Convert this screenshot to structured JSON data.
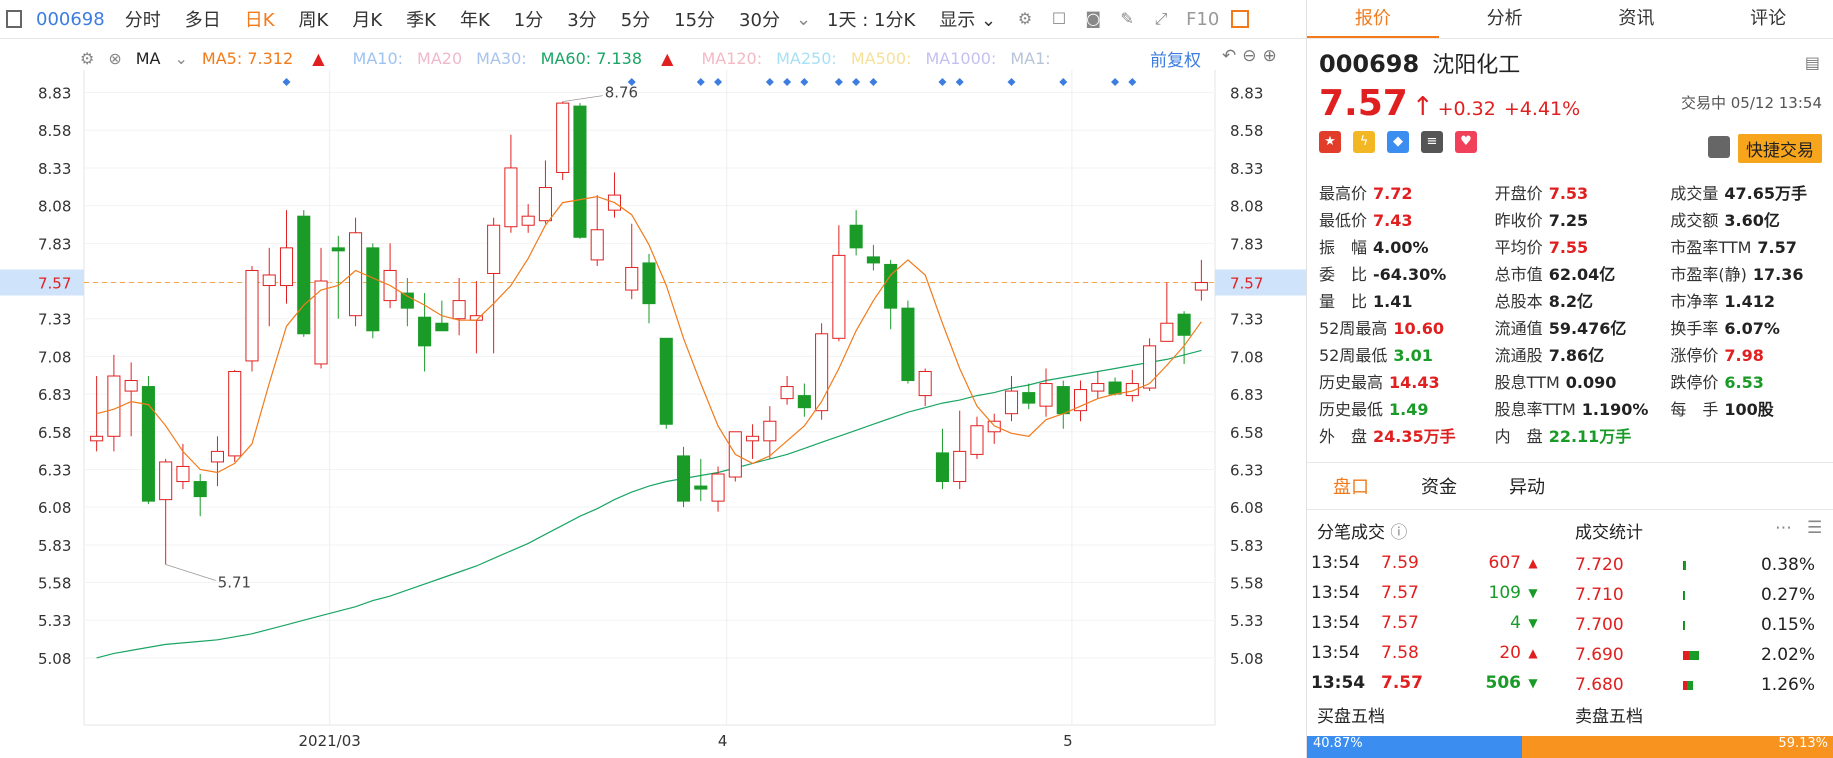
{
  "toolbar": {
    "code": "000698",
    "periods": [
      "分时",
      "多日",
      "日K",
      "周K",
      "月K",
      "季K",
      "年K",
      "1分",
      "3分",
      "5分",
      "15分",
      "30分"
    ],
    "active_period": "日K",
    "interval": "1天 : 1分K",
    "display": "显示",
    "f10": "F10"
  },
  "ma": {
    "label": "MA",
    "ma5": "MA5: 7.312",
    "ma10": "MA10:",
    "ma20": "MA20",
    "ma30": "MA30:",
    "ma60": "MA60: 7.138",
    "ma120": "MA120:",
    "ma250": "MA250:",
    "ma500": "MA500:",
    "ma1000": "MA1000:",
    "ma1": "MA1:",
    "fuquan": "前复权",
    "colors": {
      "ma5": "#f27a1a",
      "ma10": "#9ec3f0",
      "ma20": "#f0b8cc",
      "ma30": "#a8c4ec",
      "ma60": "#1aa564",
      "ma120": "#f3b9c5",
      "ma250": "#a8e0f5",
      "ma500": "#f5e19a",
      "ma1000": "#c5c0f0",
      "ma1": "#b8c4d8"
    }
  },
  "chart_data": {
    "type": "candlestick",
    "ylim": [
      5.0,
      8.9
    ],
    "y_ticks": [
      "8.83",
      "8.58",
      "8.33",
      "8.08",
      "7.83",
      "7.57",
      "7.33",
      "7.08",
      "6.83",
      "6.58",
      "6.33",
      "6.08",
      "5.83",
      "5.58",
      "5.33",
      "5.08"
    ],
    "x_labels": [
      "2021/03",
      "4",
      "5"
    ],
    "current_price": "7.57",
    "annot_high": "8.76",
    "annot_low": "5.71",
    "up_color": "#e02020",
    "down_color": "#1a9b28",
    "ma5_color": "#f27a1a",
    "ma60_color": "#1aa564",
    "candles": [
      [
        6.52,
        6.55,
        6.45,
        6.95
      ],
      [
        6.55,
        6.95,
        6.45,
        7.09
      ],
      [
        6.85,
        6.92,
        6.55,
        7.04
      ],
      [
        6.88,
        6.12,
        6.1,
        6.95
      ],
      [
        6.13,
        6.38,
        5.7,
        6.4
      ],
      [
        6.25,
        6.35,
        6.2,
        6.5
      ],
      [
        6.25,
        6.15,
        6.02,
        6.3
      ],
      [
        6.38,
        6.45,
        6.22,
        6.55
      ],
      [
        6.42,
        6.98,
        6.38,
        6.99
      ],
      [
        7.05,
        7.65,
        6.98,
        7.68
      ],
      [
        7.55,
        7.62,
        7.28,
        7.8
      ],
      [
        7.55,
        7.8,
        7.43,
        8.05
      ],
      [
        8.01,
        7.23,
        7.21,
        8.05
      ],
      [
        7.03,
        7.58,
        7.0,
        7.8
      ],
      [
        7.8,
        7.78,
        7.33,
        7.88
      ],
      [
        7.35,
        7.9,
        7.28,
        8.0
      ],
      [
        7.8,
        7.25,
        7.2,
        7.83
      ],
      [
        7.45,
        7.65,
        7.4,
        7.83
      ],
      [
        7.5,
        7.4,
        7.28,
        7.6
      ],
      [
        7.34,
        7.15,
        6.98,
        7.5
      ],
      [
        7.3,
        7.25,
        7.25,
        7.45
      ],
      [
        7.33,
        7.45,
        7.22,
        7.6
      ],
      [
        7.32,
        7.35,
        7.1,
        7.58
      ],
      [
        7.63,
        7.95,
        7.1,
        8.0
      ],
      [
        7.94,
        8.33,
        7.9,
        8.55
      ],
      [
        7.95,
        8.01,
        7.9,
        8.09
      ],
      [
        7.98,
        8.2,
        7.96,
        8.38
      ],
      [
        8.3,
        8.76,
        8.25,
        8.77
      ],
      [
        8.74,
        7.87,
        7.86,
        8.76
      ],
      [
        7.72,
        7.92,
        7.68,
        8.15
      ],
      [
        8.05,
        8.15,
        8.0,
        8.3
      ],
      [
        7.52,
        7.67,
        7.46,
        7.96
      ],
      [
        7.7,
        7.43,
        7.3,
        7.76
      ],
      [
        7.2,
        6.63,
        6.6,
        7.2
      ],
      [
        6.42,
        6.12,
        6.08,
        6.48
      ],
      [
        6.22,
        6.2,
        6.12,
        6.4
      ],
      [
        6.12,
        6.3,
        6.05,
        6.35
      ],
      [
        6.28,
        6.58,
        6.25,
        6.58
      ],
      [
        6.52,
        6.55,
        6.4,
        6.63
      ],
      [
        6.52,
        6.65,
        6.4,
        6.75
      ],
      [
        6.8,
        6.88,
        6.76,
        6.95
      ],
      [
        6.82,
        6.74,
        6.68,
        6.9
      ],
      [
        6.72,
        7.23,
        6.66,
        7.3
      ],
      [
        7.2,
        7.75,
        7.18,
        7.95
      ],
      [
        7.95,
        7.8,
        7.75,
        8.05
      ],
      [
        7.74,
        7.7,
        7.65,
        7.82
      ],
      [
        7.69,
        7.4,
        7.26,
        7.72
      ],
      [
        7.4,
        6.92,
        6.9,
        7.45
      ],
      [
        6.82,
        6.98,
        6.75,
        7.0
      ],
      [
        6.44,
        6.25,
        6.2,
        6.6
      ],
      [
        6.25,
        6.45,
        6.2,
        6.72
      ],
      [
        6.43,
        6.62,
        6.4,
        6.68
      ],
      [
        6.58,
        6.65,
        6.5,
        6.7
      ],
      [
        6.7,
        6.85,
        6.65,
        6.95
      ],
      [
        6.84,
        6.77,
        6.73,
        6.9
      ],
      [
        6.75,
        6.9,
        6.68,
        7.0
      ],
      [
        6.88,
        6.7,
        6.6,
        6.92
      ],
      [
        6.72,
        6.86,
        6.65,
        6.92
      ],
      [
        6.85,
        6.9,
        6.8,
        6.98
      ],
      [
        6.91,
        6.83,
        6.82,
        6.94
      ],
      [
        6.82,
        6.9,
        6.78,
        6.99
      ],
      [
        6.87,
        7.15,
        6.85,
        7.2
      ],
      [
        7.18,
        7.3,
        7.2,
        7.57
      ],
      [
        7.36,
        7.22,
        7.03,
        7.38
      ],
      [
        7.52,
        7.57,
        7.45,
        7.72
      ]
    ],
    "ma5": [
      6.7,
      6.73,
      6.78,
      6.76,
      6.62,
      6.45,
      6.33,
      6.31,
      6.37,
      6.5,
      6.9,
      7.28,
      7.42,
      7.52,
      7.55,
      7.65,
      7.6,
      7.55,
      7.48,
      7.42,
      7.35,
      7.32,
      7.32,
      7.43,
      7.55,
      7.73,
      7.95,
      8.1,
      8.12,
      8.14,
      8.1,
      8.02,
      7.82,
      7.55,
      7.2,
      6.9,
      6.62,
      6.43,
      6.37,
      6.42,
      6.52,
      6.62,
      6.78,
      7.0,
      7.25,
      7.45,
      7.62,
      7.72,
      7.62,
      7.3,
      7.0,
      6.75,
      6.62,
      6.57,
      6.55,
      6.66,
      6.7,
      6.75,
      6.8,
      6.83,
      6.85,
      6.9,
      7.02,
      7.15,
      7.31
    ],
    "ma60": [
      5.08,
      5.11,
      5.13,
      5.15,
      5.17,
      5.18,
      5.19,
      5.2,
      5.22,
      5.24,
      5.27,
      5.3,
      5.33,
      5.36,
      5.39,
      5.42,
      5.46,
      5.49,
      5.53,
      5.57,
      5.61,
      5.65,
      5.69,
      5.74,
      5.79,
      5.84,
      5.9,
      5.96,
      6.02,
      6.07,
      6.13,
      6.18,
      6.22,
      6.25,
      6.27,
      6.29,
      6.31,
      6.34,
      6.37,
      6.4,
      6.43,
      6.47,
      6.51,
      6.55,
      6.59,
      6.63,
      6.67,
      6.71,
      6.74,
      6.77,
      6.79,
      6.82,
      6.84,
      6.87,
      6.89,
      6.92,
      6.94,
      6.96,
      6.98,
      7.0,
      7.02,
      7.04,
      7.06,
      7.09,
      7.12
    ]
  },
  "stock": {
    "code": "000698",
    "name": "沈阳化工",
    "price": "7.57",
    "change": "+0.32",
    "pct": "+4.41%",
    "trade_time": "交易中 05/12 13:54",
    "quick_trade": "快捷交易"
  },
  "tabs": [
    "报价",
    "分析",
    "资讯",
    "评论"
  ],
  "quote": [
    [
      {
        "l": "最高价",
        "v": "7.72",
        "c": "red"
      },
      {
        "l": "开盘价",
        "v": "7.53",
        "c": "red"
      },
      {
        "l": "成交量",
        "v": "47.65万手",
        "c": "blk"
      }
    ],
    [
      {
        "l": "最低价",
        "v": "7.43",
        "c": "red"
      },
      {
        "l": "昨收价",
        "v": "7.25",
        "c": "blk"
      },
      {
        "l": "成交额",
        "v": "3.60亿",
        "c": "blk"
      }
    ],
    [
      {
        "l": "振　幅",
        "v": "4.00%",
        "c": "blk"
      },
      {
        "l": "平均价",
        "v": "7.55",
        "c": "red"
      },
      {
        "l": "市盈率TTM",
        "v": "7.57",
        "c": "blk"
      }
    ],
    [
      {
        "l": "委　比",
        "v": "-64.30%",
        "c": "blk"
      },
      {
        "l": "总市值",
        "v": "62.04亿",
        "c": "blk"
      },
      {
        "l": "市盈率(静)",
        "v": "17.36",
        "c": "blk"
      }
    ],
    [
      {
        "l": "量　比",
        "v": "1.41",
        "c": "blk"
      },
      {
        "l": "总股本",
        "v": "8.2亿",
        "c": "blk"
      },
      {
        "l": "市净率",
        "v": "1.412",
        "c": "blk"
      }
    ],
    [
      {
        "l": "52周最高",
        "v": "10.60",
        "c": "red"
      },
      {
        "l": "流通值",
        "v": "59.476亿",
        "c": "blk"
      },
      {
        "l": "换手率",
        "v": "6.07%",
        "c": "blk"
      }
    ],
    [
      {
        "l": "52周最低",
        "v": "3.01",
        "c": "green"
      },
      {
        "l": "流通股",
        "v": "7.86亿",
        "c": "blk"
      },
      {
        "l": "涨停价",
        "v": "7.98",
        "c": "red"
      }
    ],
    [
      {
        "l": "历史最高",
        "v": "14.43",
        "c": "red"
      },
      {
        "l": "股息TTM",
        "v": "0.090",
        "c": "blk"
      },
      {
        "l": "跌停价",
        "v": "6.53",
        "c": "green"
      }
    ],
    [
      {
        "l": "历史最低",
        "v": "1.49",
        "c": "green"
      },
      {
        "l": "股息率TTM",
        "v": "1.190%",
        "c": "blk"
      },
      {
        "l": "每　手",
        "v": "100股",
        "c": "blk"
      }
    ],
    [
      {
        "l": "外　盘",
        "v": "24.35万手",
        "c": "red"
      },
      {
        "l": "内　盘",
        "v": "22.11万手",
        "c": "green"
      },
      {
        "l": "",
        "v": "",
        "c": "blk"
      }
    ]
  ],
  "subtabs": [
    "盘口",
    "资金",
    "异动"
  ],
  "ticks_title": "分笔成交",
  "stats_title": "成交统计",
  "ticks": [
    {
      "t": "13:54",
      "p": "7.59",
      "v": "607",
      "d": "up"
    },
    {
      "t": "13:54",
      "p": "7.57",
      "v": "109",
      "d": "down"
    },
    {
      "t": "13:54",
      "p": "7.57",
      "v": "4",
      "d": "down"
    },
    {
      "t": "13:54",
      "p": "7.58",
      "v": "20",
      "d": "up"
    },
    {
      "t": "13:54",
      "p": "7.57",
      "v": "506",
      "d": "down"
    }
  ],
  "stats": [
    {
      "p": "7.720",
      "pct": "0.38%",
      "r": 0.38
    },
    {
      "p": "7.710",
      "pct": "0.27%",
      "r": 0.27
    },
    {
      "p": "7.700",
      "pct": "0.15%",
      "r": 0.15
    },
    {
      "p": "7.690",
      "pct": "2.02%",
      "r": 2.02
    },
    {
      "p": "7.680",
      "pct": "1.26%",
      "r": 1.26
    }
  ],
  "five": {
    "buy": "买盘五档",
    "sell": "卖盘五档",
    "buy_pct": "40.87%",
    "sell_pct": "59.13%",
    "buy_ratio": 0.4087
  }
}
